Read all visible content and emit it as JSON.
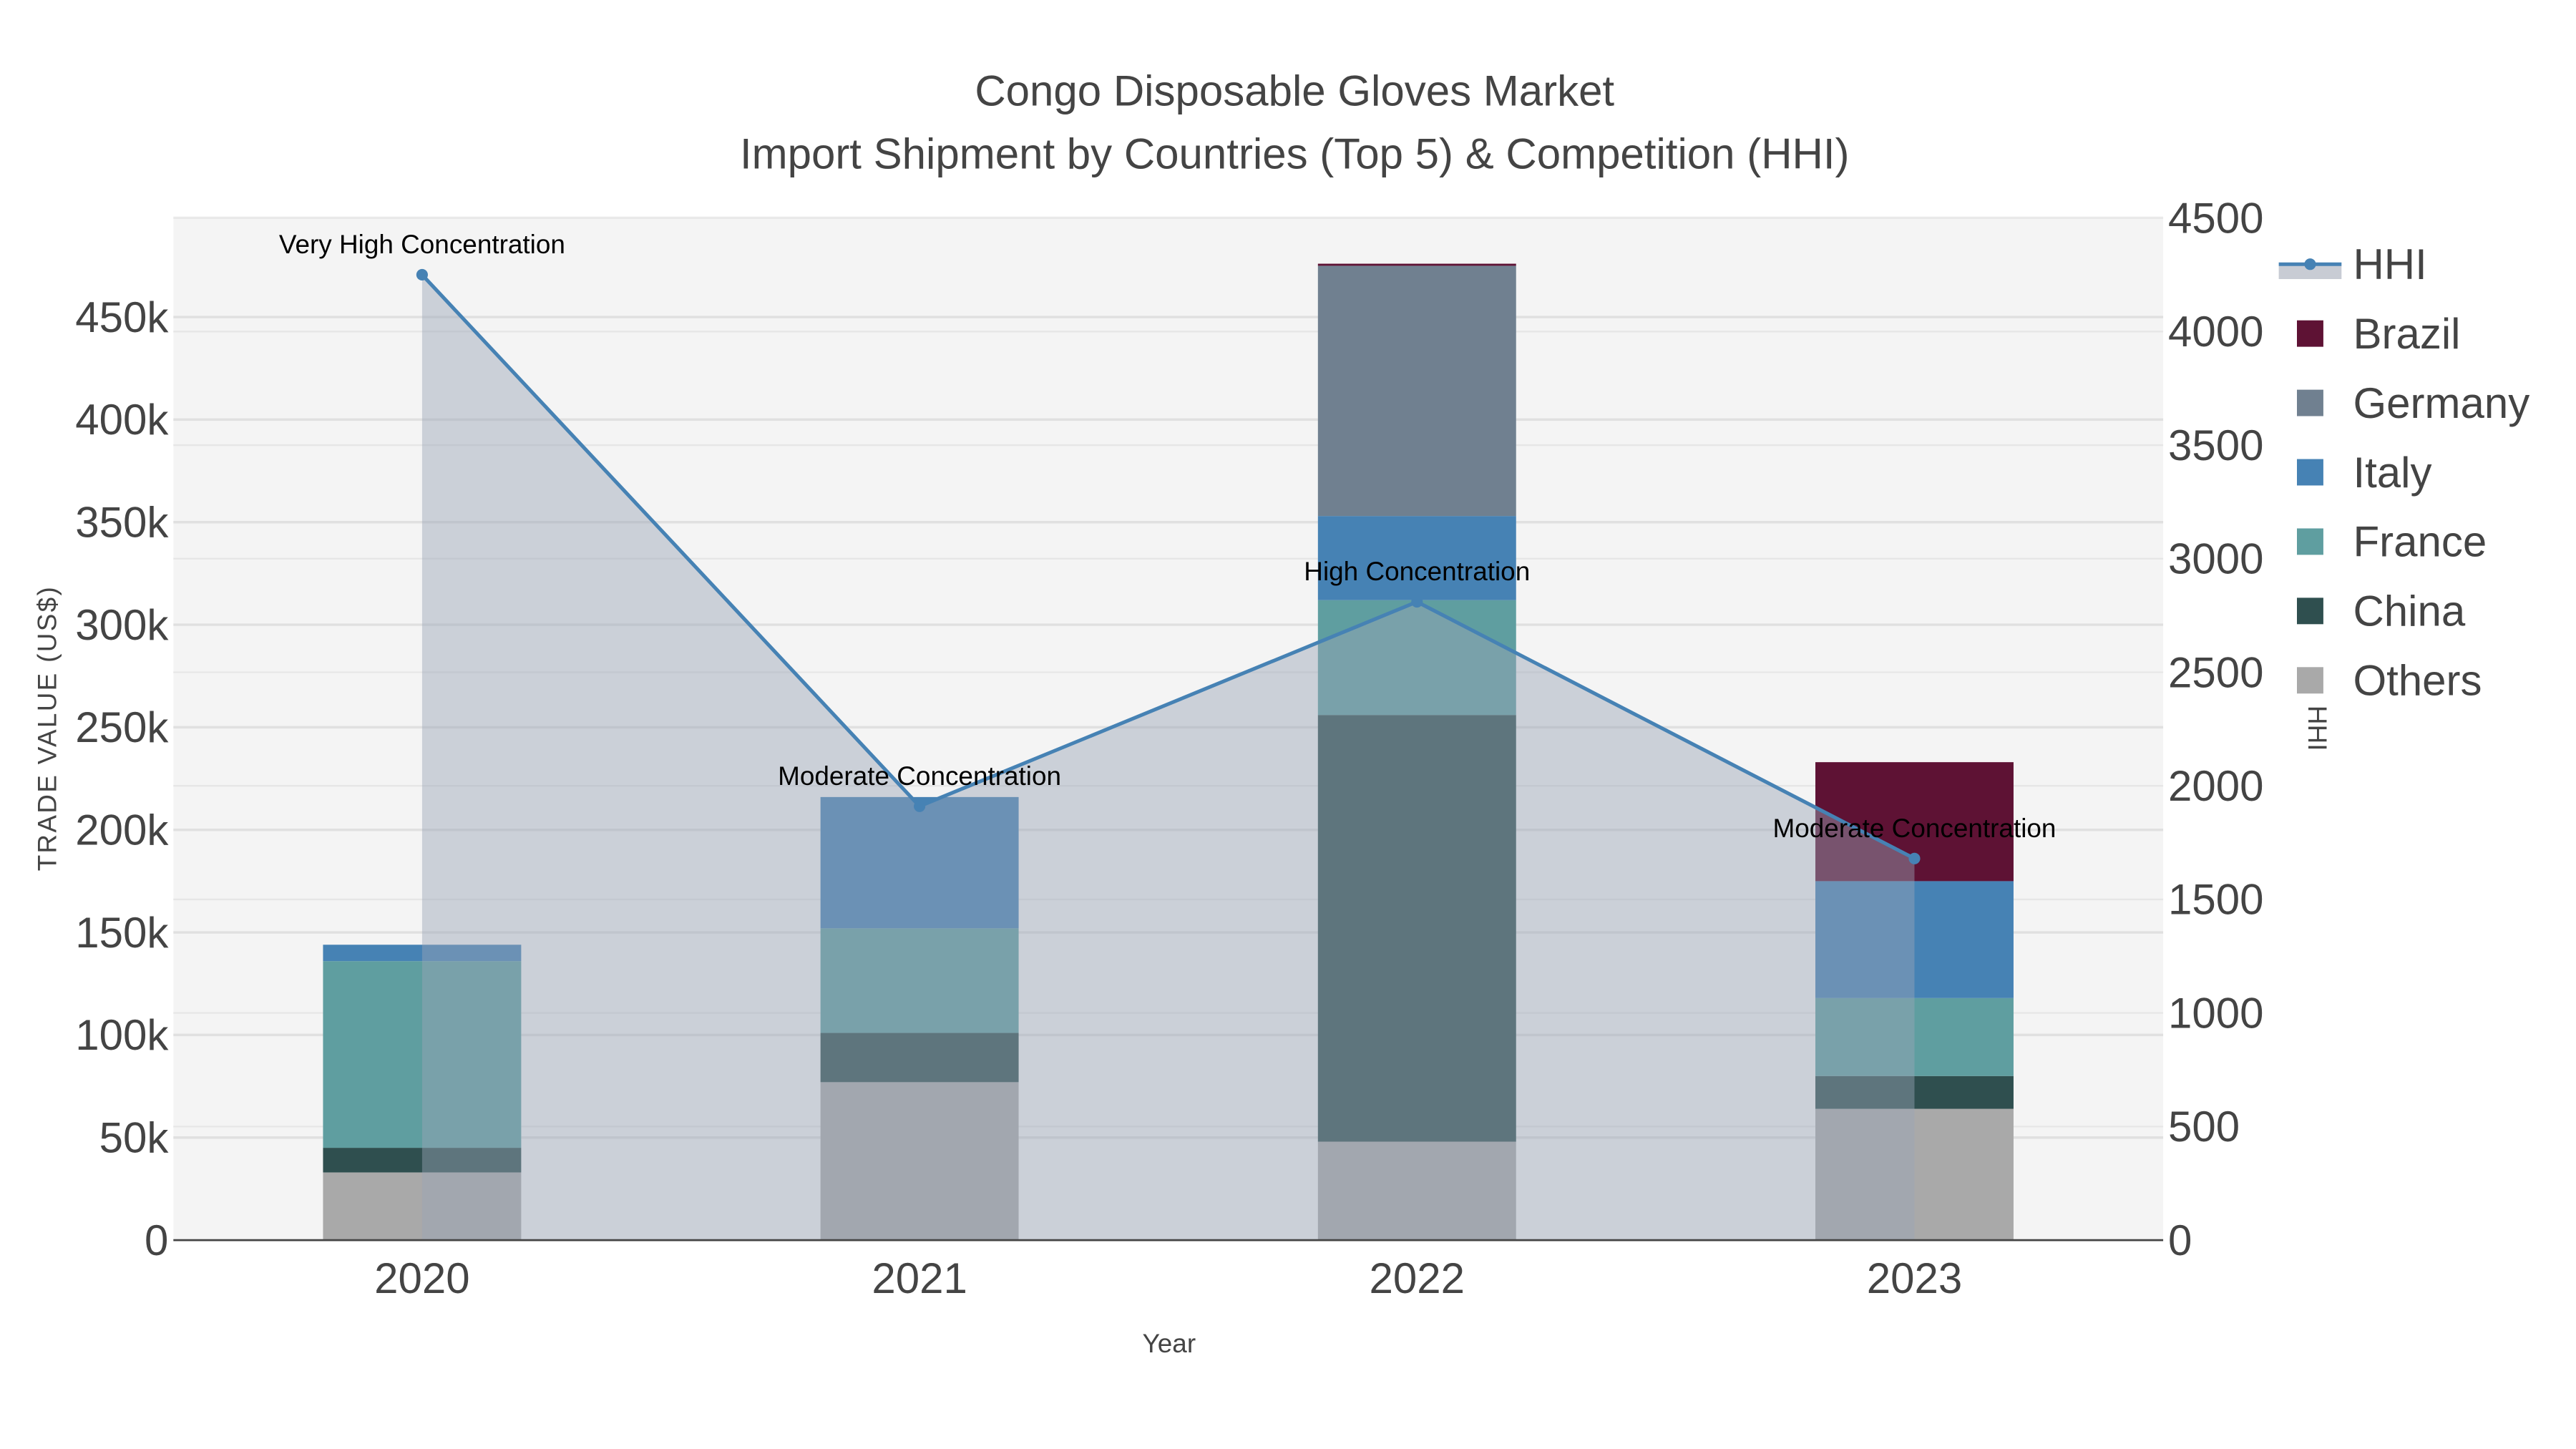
{
  "chart_data": {
    "type": "bar",
    "barmode": "stack",
    "title": "Congo Disposable Gloves Market",
    "subtitle": "Import Shipment by Countries (Top 5) & Competition (HHI)",
    "xlabel": "Year",
    "ylabel": "TRADE VALUE (US$)",
    "y2label": "HHI",
    "categories": [
      "2020",
      "2021",
      "2022",
      "2023"
    ],
    "ylim": [
      0,
      500000
    ],
    "y2lim": [
      0,
      4500
    ],
    "yticks": [
      0,
      50000,
      100000,
      150000,
      200000,
      250000,
      300000,
      350000,
      400000,
      450000
    ],
    "ytick_labels": [
      "0",
      "50k",
      "100k",
      "150k",
      "200k",
      "250k",
      "300k",
      "350k",
      "400k",
      "450k"
    ],
    "y2ticks": [
      0,
      500,
      1000,
      1500,
      2000,
      2500,
      3000,
      3500,
      4000,
      4500
    ],
    "y2tick_labels": [
      "0",
      "500",
      "1000",
      "1500",
      "2000",
      "2500",
      "3000",
      "3500",
      "4000",
      "4500"
    ],
    "grid": true,
    "legend_position": "right",
    "series": [
      {
        "name": "Others",
        "color": "#a9a9a9",
        "values": [
          33000,
          77000,
          48000,
          64000
        ]
      },
      {
        "name": "China",
        "color": "#2f4f4f",
        "values": [
          12000,
          24000,
          208000,
          16000
        ]
      },
      {
        "name": "France",
        "color": "#5f9ea0",
        "values": [
          91000,
          51000,
          56000,
          38000
        ]
      },
      {
        "name": "Italy",
        "color": "#4682b4",
        "values": [
          8000,
          64000,
          41000,
          57000
        ]
      },
      {
        "name": "Germany",
        "color": "#708090",
        "values": [
          0,
          0,
          122000,
          0
        ]
      },
      {
        "name": "Brazil",
        "color": "#5e1234",
        "values": [
          0,
          0,
          1000,
          58000
        ]
      }
    ],
    "hhi": {
      "name": "HHI",
      "color": "#4682b4",
      "values": [
        4250,
        1910,
        2810,
        1680
      ],
      "annotations": [
        "Very High Concentration",
        "Moderate Concentration",
        "High Concentration",
        "Moderate Concentration"
      ]
    },
    "legend_order": [
      "HHI",
      "Brazil",
      "Germany",
      "Italy",
      "France",
      "China",
      "Others"
    ]
  }
}
